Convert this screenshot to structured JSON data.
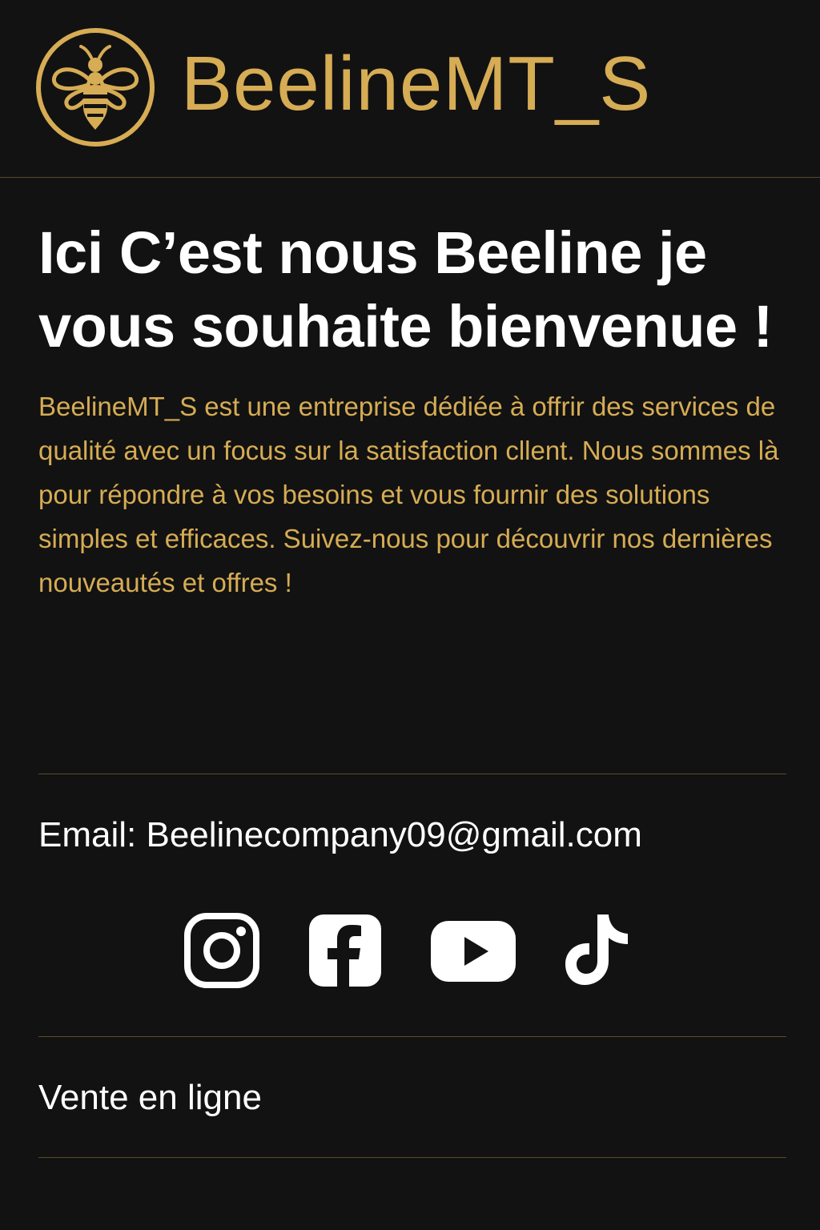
{
  "header": {
    "logo_icon": "bee-icon",
    "brand_name": "BeelineMT_S"
  },
  "main": {
    "headline": "Ici C’est nous Beeline je vous souhaite bienvenue !",
    "description": "BeelineMT_S est une entreprise dédiée à offrir des services de qualité avec un focus sur la satisfaction cllent. Nous sommes là pour répondre à vos besoins et vous fournir des solutions simples et efficaces. Suivez-nous pour découvrir nos dernières nouveautés et offres !"
  },
  "contact": {
    "email_text": "Email: Beelinecompany09@gmail.com"
  },
  "social": [
    {
      "icon": "instagram-icon"
    },
    {
      "icon": "facebook-icon"
    },
    {
      "icon": "youtube-icon"
    },
    {
      "icon": "tiktok-icon"
    }
  ],
  "footer": {
    "text": "Vente en ligne"
  },
  "colors": {
    "background": "#121212",
    "accent_gold": "#d6ac54",
    "text_white": "#ffffff",
    "divider": "#5a4a2a"
  }
}
